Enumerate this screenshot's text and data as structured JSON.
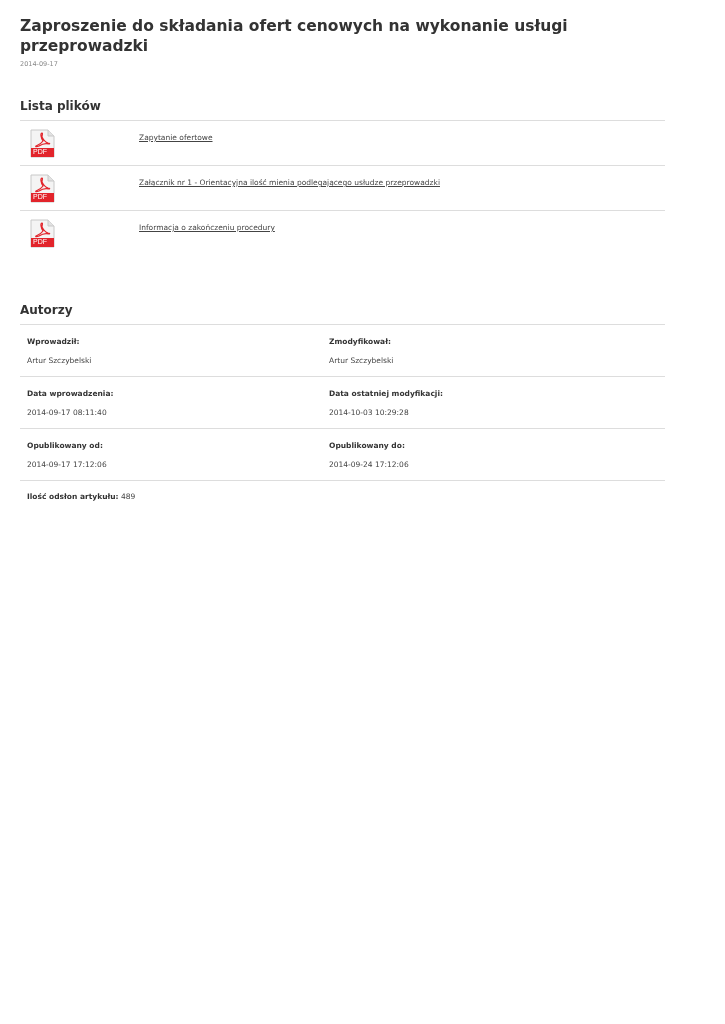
{
  "title": "Zaproszenie do składania ofert cenowych na wykonanie usługi przeprowadzki",
  "date": "2014-09-17",
  "files_section": {
    "heading": "Lista plików",
    "files": [
      {
        "type": "PDF",
        "name": "Zapytanie ofertowe"
      },
      {
        "type": "PDF",
        "name": "Załącznik nr 1 - Orientacyjna ilość mienia podlegającego usłudze przeprowadzki"
      },
      {
        "type": "PDF",
        "name": "Informacja o zakończeniu procedury"
      }
    ]
  },
  "authors_section": {
    "heading": "Autorzy",
    "rows": [
      [
        {
          "label": "Wprowadził:",
          "value": "Artur Szczybelski"
        },
        {
          "label": "Zmodyfikował:",
          "value": "Artur Szczybelski"
        }
      ],
      [
        {
          "label": "Data wprowadzenia:",
          "value": "2014-09-17 08:11:40"
        },
        {
          "label": "Data ostatniej modyfikacji:",
          "value": "2014-10-03 10:29:28"
        }
      ],
      [
        {
          "label": "Opublikowany od:",
          "value": "2014-09-17 17:12:06"
        },
        {
          "label": "Opublikowany do:",
          "value": "2014-09-24 17:12:06"
        }
      ]
    ]
  },
  "views": "**Ilość odsłon artykułu:** 489"
}
